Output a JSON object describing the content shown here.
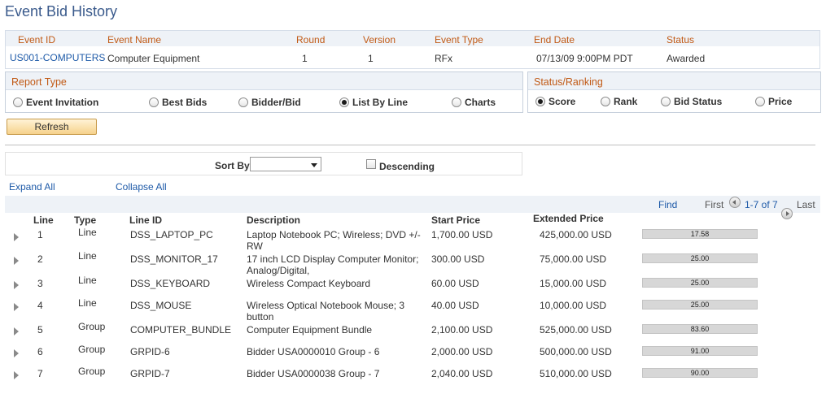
{
  "page_title": "Event Bid History",
  "event": {
    "headers": [
      "Event ID",
      "Event Name",
      "Round",
      "Version",
      "Event Type",
      "End Date",
      "Status"
    ],
    "event_id": "US001-COMPUTERS",
    "event_name": "Computer Equipment",
    "round": "1",
    "version": "1",
    "event_type": "RFx",
    "end_date": "07/13/09  9:00PM PDT",
    "status": "Awarded"
  },
  "report_type": {
    "title": "Report Type",
    "options": [
      "Event Invitation",
      "Best Bids",
      "Bidder/Bid",
      "List By Line",
      "Charts"
    ],
    "selected": "List By Line"
  },
  "status_ranking": {
    "title": "Status/Ranking",
    "options": [
      "Score",
      "Rank",
      "Bid Status",
      "Price"
    ],
    "selected": "Score"
  },
  "refresh_label": "Refresh",
  "sort": {
    "label": "Sort By",
    "value": "",
    "descending_label": "Descending",
    "descending_checked": false
  },
  "expand_all": "Expand All",
  "collapse_all": "Collapse All",
  "grid_nav": {
    "find": "Find",
    "first": "First",
    "range": "1-7 of 7",
    "last": "Last"
  },
  "columns": [
    "Line",
    "Type",
    "Line ID",
    "Description",
    "Start Price",
    "Extended Price"
  ],
  "rows": [
    {
      "line": "1",
      "type": "Line",
      "line_id": "DSS_LAPTOP_PC",
      "description": "Laptop Notebook PC; Wireless; DVD +/- RW",
      "start_price": "1,700.00 USD",
      "extended_price": "425,000.00 USD",
      "score": "17.58"
    },
    {
      "line": "2",
      "type": "Line",
      "line_id": "DSS_MONITOR_17",
      "description": "17 inch LCD Display Computer Monitor; Analog/Digital,",
      "start_price": "300.00 USD",
      "extended_price": "75,000.00 USD",
      "score": "25.00"
    },
    {
      "line": "3",
      "type": "Line",
      "line_id": "DSS_KEYBOARD",
      "description": "Wireless Compact Keyboard",
      "start_price": "60.00 USD",
      "extended_price": "15,000.00 USD",
      "score": "25.00"
    },
    {
      "line": "4",
      "type": "Line",
      "line_id": "DSS_MOUSE",
      "description": "Wireless Optical Notebook Mouse; 3 button",
      "start_price": "40.00 USD",
      "extended_price": "10,000.00 USD",
      "score": "25.00"
    },
    {
      "line": "5",
      "type": "Group",
      "line_id": "COMPUTER_BUNDLE",
      "description": "Computer Equipment Bundle",
      "start_price": "2,100.00 USD",
      "extended_price": "525,000.00 USD",
      "score": "83.60"
    },
    {
      "line": "6",
      "type": "Group",
      "line_id": "GRPID-6",
      "description": "Bidder USA0000010 Group - 6",
      "start_price": "2,000.00 USD",
      "extended_price": "500,000.00 USD",
      "score": "91.00"
    },
    {
      "line": "7",
      "type": "Group",
      "line_id": "GRPID-7",
      "description": "Bidder USA0000038 Group - 7",
      "start_price": "2,040.00 USD",
      "extended_price": "510,000.00 USD",
      "score": "90.00"
    }
  ]
}
